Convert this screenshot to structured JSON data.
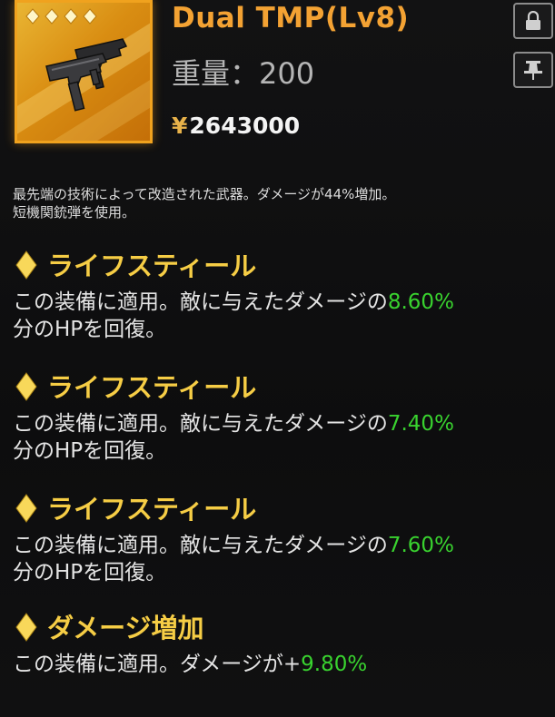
{
  "item": {
    "name": "Dual TMP(Lv8)",
    "weight_text": "重量：200",
    "price_symbol": "¥",
    "price": "2643000",
    "star_count": 4,
    "icon": "smg-weapon-icon",
    "frame_color": "#f0a21e"
  },
  "buttons": {
    "lock_icon": "lock-icon",
    "pin_icon": "pin-icon"
  },
  "description": {
    "line1": "最先端の技術によって改造された武器。ダメージが44%増加。",
    "line2": "短機関銃弾を使用。"
  },
  "effects": [
    {
      "name": "ライフスティール",
      "text_pre": "この装備に適用。敵に与えたダメージの",
      "value": "8.60%",
      "text_line2": "分のHPを回復。"
    },
    {
      "name": "ライフスティール",
      "text_pre": "この装備に適用。敵に与えたダメージの",
      "value": "7.40%",
      "text_line2": "分のHPを回復。"
    },
    {
      "name": "ライフスティール",
      "text_pre": "この装備に適用。敵に与えたダメージの",
      "value": "7.60%",
      "text_line2": "分のHPを回復。"
    },
    {
      "name": "ダメージ増加",
      "text_pre": "この装備に適用。ダメージが+",
      "value": "9.80%",
      "text_line2": ""
    }
  ],
  "colors": {
    "title": "#f3a233",
    "effect_name": "#f6cd45",
    "value_green": "#39d22f",
    "background": "#0c0c0d"
  }
}
